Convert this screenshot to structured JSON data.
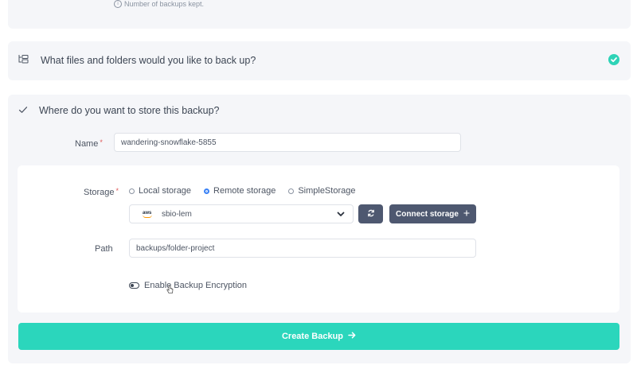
{
  "retention": {
    "hint": "Number of backups kept."
  },
  "files_section": {
    "title": "What files and folders would you like to back up?",
    "completed": true
  },
  "storage_section": {
    "title": "Where do you want to store this backup?",
    "name_label": "Name",
    "name_value": "wandering-snowflake-5855",
    "storage_label": "Storage",
    "options": [
      {
        "label": "Local storage",
        "selected": false
      },
      {
        "label": "Remote storage",
        "selected": true
      },
      {
        "label": "SimpleStorage",
        "selected": false
      }
    ],
    "remote_selected": "sbio-lem",
    "connect_label": "Connect storage",
    "path_label": "Path",
    "path_value": "backups/folder-project",
    "encryption_label": "Enable Backup Encryption",
    "encryption_enabled": false
  },
  "create_button": {
    "label": "Create Backup"
  },
  "colors": {
    "accent": "#2bd6bc",
    "dark_button": "#4e5870",
    "panel_bg": "#f5f6f9",
    "radio_active": "#3b82f6"
  }
}
